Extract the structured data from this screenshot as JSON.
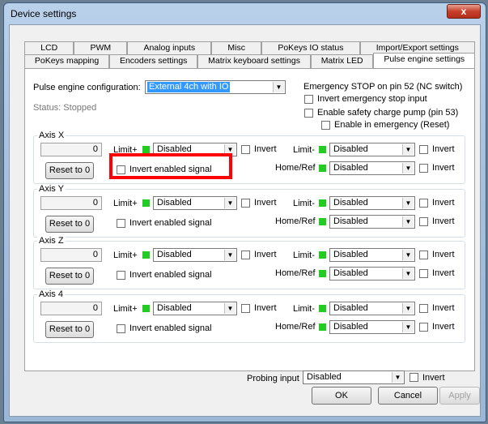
{
  "window": {
    "title": "Device settings",
    "close_glyph": "x"
  },
  "tabs_row1": [
    "LCD",
    "PWM",
    "Analog inputs",
    "Misc",
    "PoKeys IO status",
    "Import/Export settings"
  ],
  "tabs_row2": [
    "PoKeys mapping",
    "Encoders settings",
    "Matrix keyboard settings",
    "Matrix LED",
    "Pulse engine settings"
  ],
  "active_tab": "Pulse engine settings",
  "pulse_engine": {
    "config_label": "Pulse engine configuration:",
    "config_value": "External 4ch with IO",
    "status": "Status: Stopped"
  },
  "estop": {
    "title": "Emergency STOP on pin 52 (NC switch)",
    "invert_label": "Invert emergency stop input",
    "safety_label": "Enable safety charge pump (pin 53)",
    "enable_in_emergency_label": "Enable in emergency (Reset)"
  },
  "labels": {
    "limit_plus": "Limit+",
    "limit_minus": "Limit-",
    "home_ref": "Home/Ref",
    "invert": "Invert",
    "invert_enabled_signal": "Invert enabled signal",
    "reset_button": "Reset to 0"
  },
  "axes": [
    {
      "name": "Axis X",
      "position": "0",
      "limit_plus": "Disabled",
      "limit_minus": "Disabled",
      "home_ref": "Disabled"
    },
    {
      "name": "Axis Y",
      "position": "0",
      "limit_plus": "Disabled",
      "limit_minus": "Disabled",
      "home_ref": "Disabled"
    },
    {
      "name": "Axis Z",
      "position": "0",
      "limit_plus": "Disabled",
      "limit_minus": "Disabled",
      "home_ref": "Disabled"
    },
    {
      "name": "Axis 4",
      "position": "0",
      "limit_plus": "Disabled",
      "limit_minus": "Disabled",
      "home_ref": "Disabled"
    }
  ],
  "probing": {
    "label": "Probing input",
    "value": "Disabled",
    "invert_label": "Invert"
  },
  "footer": {
    "ok": "OK",
    "cancel": "Cancel",
    "apply": "Apply"
  },
  "colors": {
    "led": "#22cc22",
    "highlight": "#ff0000",
    "selection": "#3399ff"
  },
  "icons": {
    "dropdown": "chevron-down-icon",
    "close": "close-icon"
  }
}
